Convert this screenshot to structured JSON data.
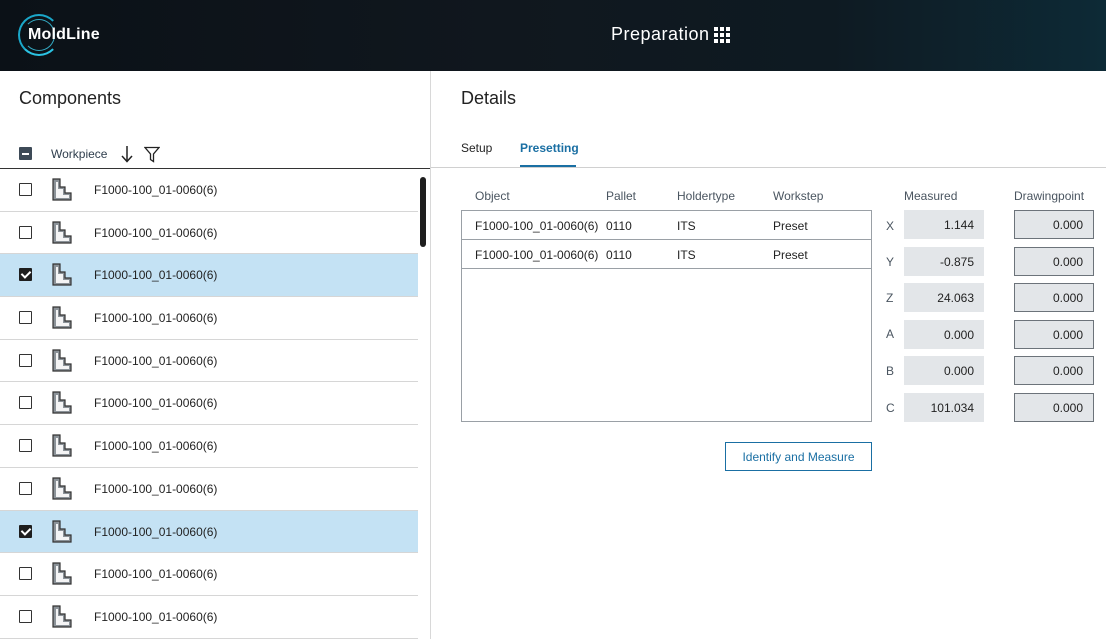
{
  "header": {
    "logo_text": "MoldLine",
    "title": "Preparation",
    "apps_icon": "grid-apps-icon"
  },
  "components": {
    "title": "Components",
    "column_label": "Workpiece",
    "sort_icon": "arrow-down-icon",
    "filter_icon": "filter-icon",
    "items": [
      {
        "label": "F1000-100_01-0060(6)",
        "checked": false
      },
      {
        "label": "F1000-100_01-0060(6)",
        "checked": false
      },
      {
        "label": "F1000-100_01-0060(6)",
        "checked": true
      },
      {
        "label": "F1000-100_01-0060(6)",
        "checked": false
      },
      {
        "label": "F1000-100_01-0060(6)",
        "checked": false
      },
      {
        "label": "F1000-100_01-0060(6)",
        "checked": false
      },
      {
        "label": "F1000-100_01-0060(6)",
        "checked": false
      },
      {
        "label": "F1000-100_01-0060(6)",
        "checked": false
      },
      {
        "label": "F1000-100_01-0060(6)",
        "checked": true
      },
      {
        "label": "F1000-100_01-0060(6)",
        "checked": false
      },
      {
        "label": "F1000-100_01-0060(6)",
        "checked": false
      }
    ]
  },
  "details": {
    "title": "Details",
    "tabs": [
      {
        "label": "Setup",
        "active": false
      },
      {
        "label": "Presetting",
        "active": true
      }
    ],
    "table": {
      "columns": [
        "Object",
        "Pallet",
        "Holdertype",
        "Workstep"
      ],
      "rows": [
        [
          "F1000-100_01-0060(6)",
          "0110",
          "ITS",
          "Preset"
        ],
        [
          "F1000-100_01-0060(6)",
          "0110",
          "ITS",
          "Preset"
        ]
      ]
    },
    "measured_label": "Measured",
    "drawingpoint_label": "Drawingpoint",
    "axes": [
      {
        "axis": "X",
        "measured": "1.144",
        "drawingpoint": "0.000"
      },
      {
        "axis": "Y",
        "measured": "-0.875",
        "drawingpoint": "0.000"
      },
      {
        "axis": "Z",
        "measured": "24.063",
        "drawingpoint": "0.000"
      },
      {
        "axis": "A",
        "measured": "0.000",
        "drawingpoint": "0.000"
      },
      {
        "axis": "B",
        "measured": "0.000",
        "drawingpoint": "0.000"
      },
      {
        "axis": "C",
        "measured": "101.034",
        "drawingpoint": "0.000"
      }
    ],
    "action_label": "Identify and Measure"
  },
  "colors": {
    "accent": "#1a6fa3",
    "selected_row": "#c4e2f4",
    "header_bg": "#0b1117"
  }
}
